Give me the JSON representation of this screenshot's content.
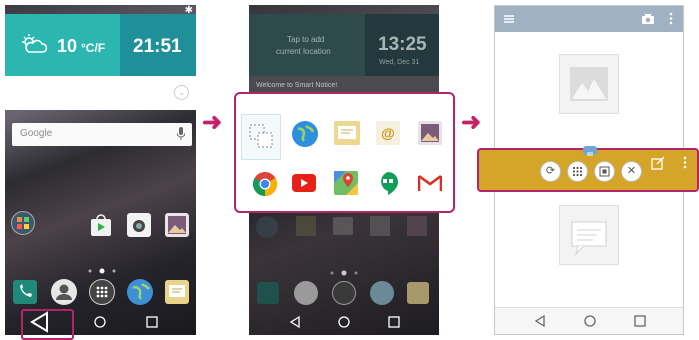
{
  "phone1": {
    "weather_temp": "10",
    "weather_unit": "°C/F",
    "clock_time": "21:51",
    "search_placeholder": "Google"
  },
  "phone2": {
    "notice_text_line1": "Tap to add",
    "notice_text_line2": "current location",
    "clock_time": "13:25",
    "clock_date": "Wed, Dec 31",
    "welcome_text": "Welcome to Smart Notice!"
  },
  "arrows": {
    "arrow_glyph": "➜"
  },
  "colors": {
    "highlight_border": "#b4246a",
    "qslide_bar": "#d4a528",
    "weather_tile": "#2bb7b0",
    "clock_tile": "#1f8f9a"
  },
  "popup_apps": [
    "qslide-icon",
    "browser-icon",
    "memo-icon",
    "email-icon",
    "gallery-icon",
    "chrome-icon",
    "youtube-icon",
    "maps-icon",
    "hangouts-icon",
    "gmail-icon"
  ]
}
